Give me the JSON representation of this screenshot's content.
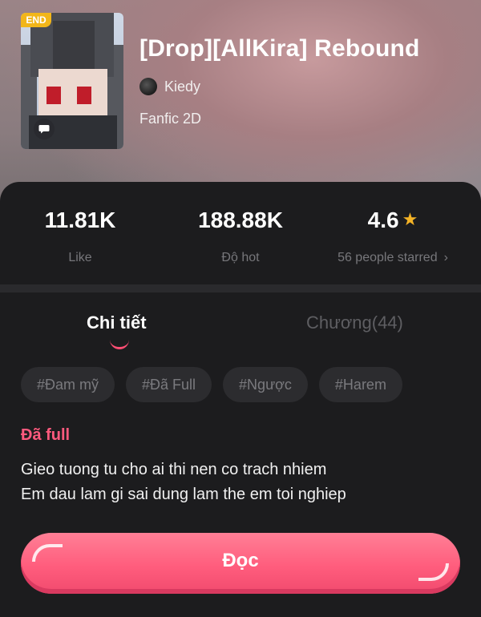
{
  "book": {
    "badge": "END",
    "title": "[Drop][AllKira] Rebound",
    "author": "Kiedy",
    "genre": "Fanfic 2D"
  },
  "stats": {
    "likes_value": "11.81K",
    "likes_label": "Like",
    "hot_value": "188.88K",
    "hot_label": "Độ hot",
    "rating_value": "4.6",
    "rating_label": "56 people starred",
    "rating_chevron": "›"
  },
  "tabs": {
    "details": "Chi tiết",
    "chapters": "Chương(44)"
  },
  "tags": [
    "#Đam mỹ",
    "#Đã Full",
    "#Ngược",
    "#Harem"
  ],
  "status": "Đã full",
  "description": {
    "line1": "Gieo tuong tu cho ai thi nen co trach nhiem",
    "line2": "Em dau lam gi sai dung lam the em toi nghiep"
  },
  "read_button": "Đọc",
  "colors": {
    "accent_pink": "#ff5a7e",
    "badge_yellow": "#f2b619",
    "star_gold": "#f4b326",
    "background": "#1c1c1e"
  }
}
